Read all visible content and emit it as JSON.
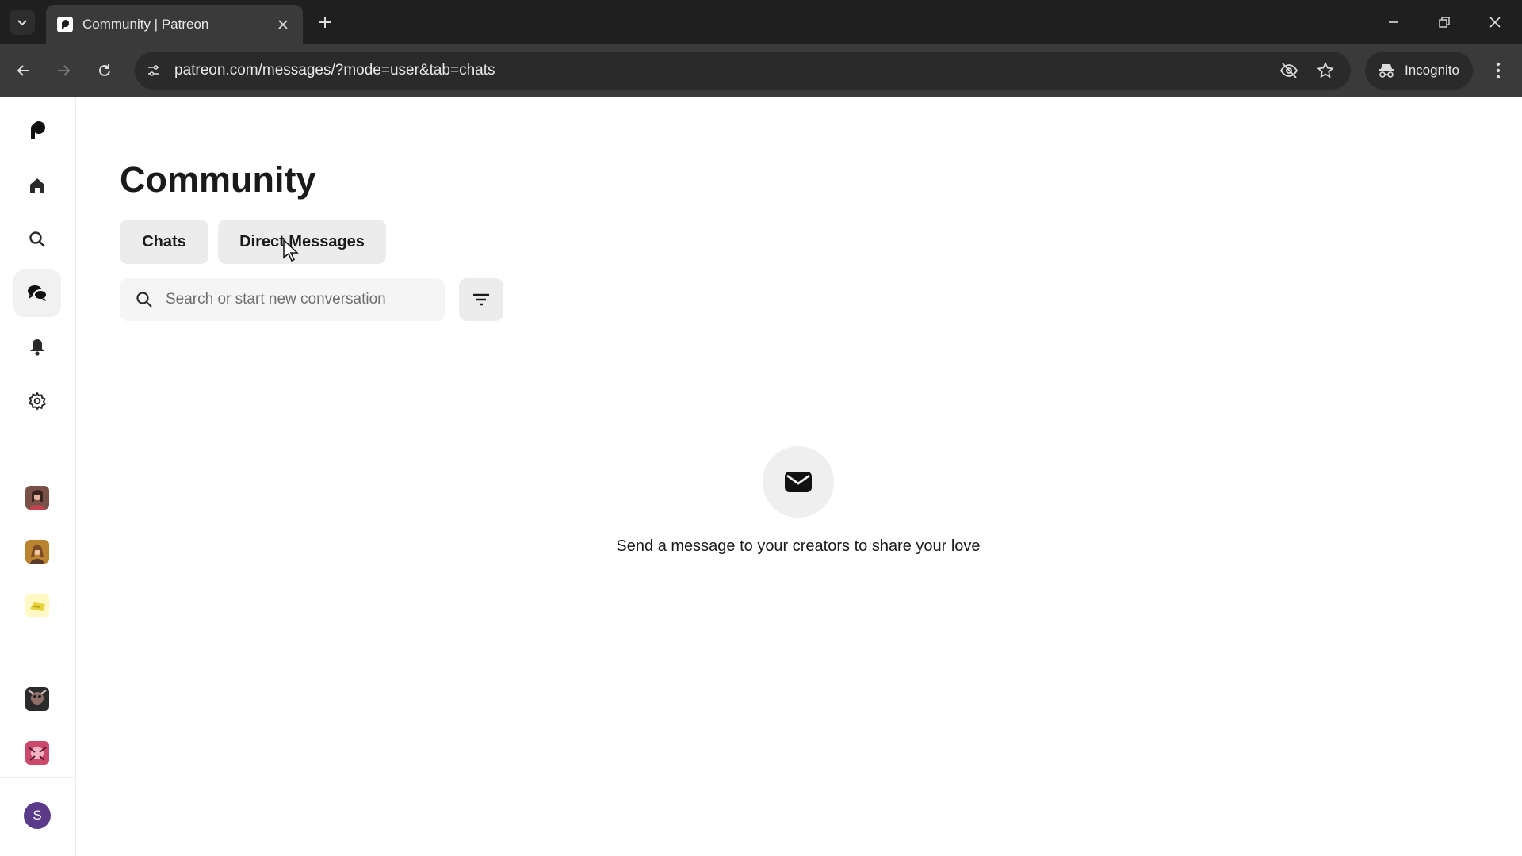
{
  "browser": {
    "tab_title": "Community | Patreon",
    "url": "patreon.com/messages/?mode=user&tab=chats",
    "incognito_label": "Incognito"
  },
  "sidebar": {
    "items": [
      {
        "name": "patreon-logo",
        "icon": "patreon-logo-icon"
      },
      {
        "name": "home",
        "icon": "home-icon"
      },
      {
        "name": "search",
        "icon": "search-icon"
      },
      {
        "name": "community",
        "icon": "chat-bubbles-icon",
        "active": true
      },
      {
        "name": "notifications",
        "icon": "bell-icon"
      },
      {
        "name": "settings",
        "icon": "gear-icon"
      }
    ],
    "creators": [
      "creator-avatar-1",
      "creator-avatar-2",
      "creator-avatar-3",
      "creator-avatar-4",
      "creator-avatar-5"
    ],
    "user_initial": "S"
  },
  "main": {
    "title": "Community",
    "tabs": [
      {
        "label": "Chats",
        "selected": true
      },
      {
        "label": "Direct Messages",
        "selected": false
      }
    ],
    "search": {
      "placeholder": "Search or start new conversation",
      "value": ""
    },
    "empty_state": {
      "icon": "envelope-icon",
      "message": "Send a message to your creators to share your love"
    }
  },
  "colors": {
    "titlebar": "#1f1f1f",
    "toolbar": "#3a3a3a",
    "accent_avatar": "#5b3a8a"
  }
}
